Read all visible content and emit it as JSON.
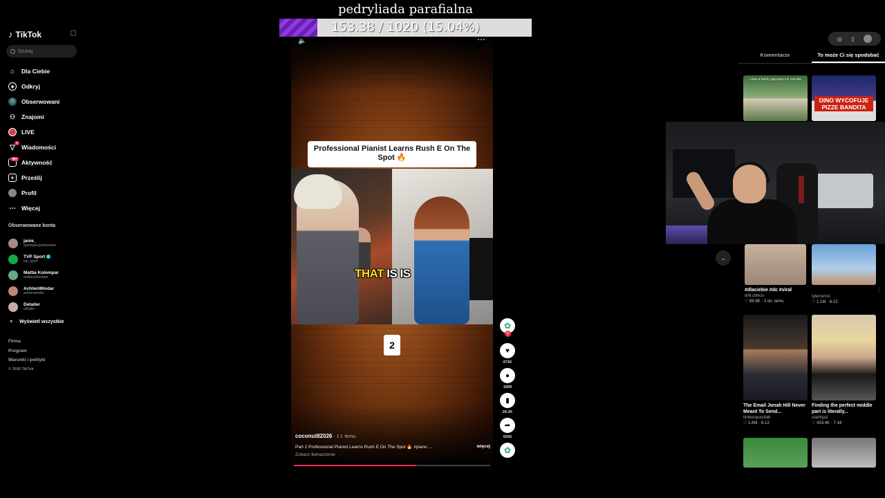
{
  "stream_overlay": {
    "title": "pedryliada parafialna",
    "progress_text": "153.38 / 1020 (15.04%)",
    "progress_fraction": 0.1504
  },
  "sidebar": {
    "logo": "TikTok",
    "search_placeholder": "Szukaj",
    "nav": [
      {
        "label": "Dla Ciebie",
        "icon": "home-icon"
      },
      {
        "label": "Odkryj",
        "icon": "compass-icon"
      },
      {
        "label": "Obserwowani",
        "icon": "avatar-icon"
      },
      {
        "label": "Znajomi",
        "icon": "friends-icon"
      },
      {
        "label": "LIVE",
        "icon": "live-icon"
      },
      {
        "label": "Wiadomości",
        "icon": "send-icon",
        "badge": "1"
      },
      {
        "label": "Aktywność",
        "icon": "inbox-icon",
        "badge": "99+"
      },
      {
        "label": "Prześlij",
        "icon": "upload-icon"
      },
      {
        "label": "Profil",
        "icon": "profile-icon"
      },
      {
        "label": "Więcej",
        "icon": "more-icon"
      }
    ],
    "followed_title": "Obserwowane konta",
    "accounts": [
      {
        "name": "janie_",
        "handle": "queenpussyboss|ane",
        "verified": false
      },
      {
        "name": "TVP Sport",
        "handle": "tvp_sport",
        "verified": true
      },
      {
        "name": "Mattia Kolompar",
        "handle": "mattia.kolompar",
        "verified": false
      },
      {
        "name": "AchtenWłodar",
        "handle": "achtenwlodar",
        "verified": false
      },
      {
        "name": "Detailer",
        "handle": "d3tailer",
        "verified": false
      }
    ],
    "show_all": "Wyświetl wszystkie",
    "footer": [
      "Firma",
      "Program",
      "Warunki i polityki",
      "© 2026 TikTok"
    ]
  },
  "video": {
    "caption": "Professional Pianist Learns Rush E On The Spot 🔥",
    "subtitle_word1": "THAT",
    "subtitle_word2": "IS IS",
    "counter": "2",
    "author": "coconut82026",
    "time": "· 1 t. temu",
    "description": "Part 2 Professional Pianist Learns Rush E On The Spot 🔥 #piano ...",
    "more": "więcej",
    "translate": "Zobacz tłumaczenie",
    "playback_fraction": 0.62
  },
  "actions": {
    "likes": "473K",
    "comments": "1899",
    "saves": "28.3K",
    "shares": "6550"
  },
  "right_panel": {
    "tabs": [
      "Komentarze",
      "To może Ci się spodobać"
    ],
    "active_tab": 1,
    "cards": [
      {
        "overlay": "Lewica kiedy zapytasz ich zarobki",
        "title": "",
        "meta": "",
        "stats": ""
      },
      {
        "overlay": "DINO WYCOFUJE PIZZE BANDITA",
        "title": "",
        "meta": "",
        "stats": ""
      },
      {
        "overlay": "",
        "title": "#dlaciebie #dc #viral",
        "meta": "drill.clilvcis",
        "stats": "♡ 69.9K · 2 dn. temu"
      },
      {
        "overlay": "",
        "title": "",
        "meta": "tylerrernst",
        "stats": "♡ 1.1M · 6-21"
      },
      {
        "overlay": "",
        "title": "The Email Jonah Hill Never Meant To Send...",
        "meta": "timberquestlab",
        "stats": "♡ 1.6M · 6-12"
      },
      {
        "overlay": "",
        "title": "Finding the perfect middle part is literally...",
        "meta": "utahlsjaz",
        "stats": "♡ 433.4K · 7-16"
      }
    ]
  },
  "colors": {
    "accent": "#fe2c55",
    "progress_purple": "#7b2bc8",
    "verified": "#20d5ec"
  }
}
